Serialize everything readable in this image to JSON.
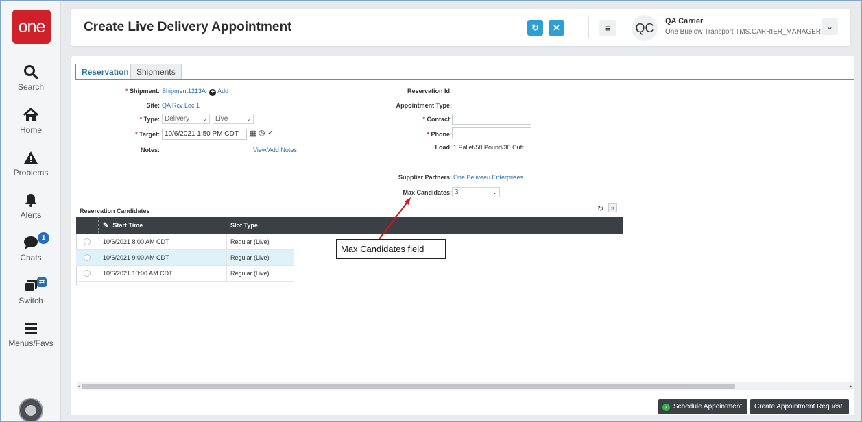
{
  "sidebar": {
    "logo": "one",
    "items": [
      {
        "label": "Search",
        "icon": "search-icon"
      },
      {
        "label": "Home",
        "icon": "home-icon"
      },
      {
        "label": "Problems",
        "icon": "warning-icon"
      },
      {
        "label": "Alerts",
        "icon": "bell-icon"
      },
      {
        "label": "Chats",
        "icon": "chat-icon",
        "badge": "1"
      },
      {
        "label": "Switch",
        "icon": "switch-icon"
      },
      {
        "label": "Menus/Favs",
        "icon": "menu-icon"
      }
    ]
  },
  "header": {
    "title": "Create Live Delivery Appointment",
    "user_initials": "QC",
    "user_name": "QA Carrier",
    "user_role": "One Buelow Transport TMS.CARRIER_MANAGER"
  },
  "tabs": [
    {
      "label": "Reservation",
      "active": true
    },
    {
      "label": "Shipments",
      "active": false
    }
  ],
  "form": {
    "shipment_label": "Shipment:",
    "shipment_value": "Shipment1213A",
    "add_label": "Add",
    "site_label": "Site:",
    "site_value": "QA Rcv Loc 1",
    "type_label": "Type:",
    "type_value": "Delivery",
    "mode_value": "Live",
    "target_label": "Target:",
    "target_value": "10/6/2021 1:50 PM CDT",
    "notes_label": "Notes:",
    "notes_link": "View/Add Notes",
    "reservation_id_label": "Reservation Id:",
    "appointment_type_label": "Appointment Type:",
    "contact_label": "Contact:",
    "phone_label": "Phone:",
    "load_label": "Load:",
    "load_value": "1 Pallet/50 Pound/30 Cuft",
    "supplier_label": "Supplier Partners:",
    "supplier_value": "One Beliveau Enterprises",
    "max_candidates_label": "Max Candidates:",
    "max_candidates_value": "3"
  },
  "candidates": {
    "title": "Reservation Candidates",
    "columns": [
      "Start Time",
      "Slot Type"
    ],
    "rows": [
      {
        "start": "10/6/2021 8:00 AM CDT",
        "slot": "Regular (Live)",
        "selected": false
      },
      {
        "start": "10/6/2021 9:00 AM CDT",
        "slot": "Regular (Live)",
        "selected": true
      },
      {
        "start": "10/6/2021 10:00 AM CDT",
        "slot": "Regular (Live)",
        "selected": false
      }
    ]
  },
  "annotation": {
    "text": "Max Candidates field",
    "color": "#e01010"
  },
  "footer": {
    "schedule_label": "Schedule Appointment",
    "create_label": "Create Appointment Request"
  },
  "colors": {
    "brand": "#d0202a",
    "accent": "#2f9fd3",
    "grid_header": "#3b4046"
  }
}
